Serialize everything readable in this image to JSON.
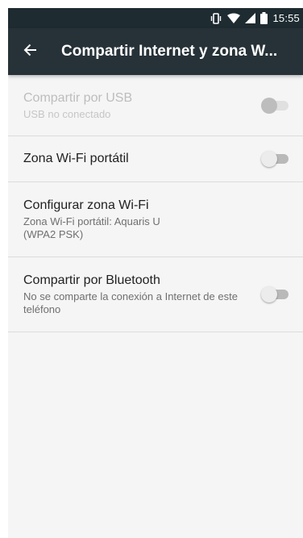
{
  "status_bar": {
    "time": "15:55",
    "icons": [
      "vibrate-icon",
      "wifi-icon",
      "cell-signal-icon",
      "battery-icon"
    ]
  },
  "app_bar": {
    "title": "Compartir Internet y zona W...",
    "back_icon": "arrow-back-icon"
  },
  "settings": {
    "usb": {
      "title": "Compartir por USB",
      "summary": "USB no conectado",
      "enabled": false,
      "checked": false
    },
    "hotspot": {
      "title": "Zona Wi-Fi portátil",
      "checked": false
    },
    "config": {
      "title": "Configurar zona Wi-Fi",
      "summary_line1": "Zona Wi-Fi portátil: Aquaris U",
      "summary_line2": "(WPA2 PSK)"
    },
    "bluetooth": {
      "title": "Compartir por Bluetooth",
      "summary": "No se comparte la conexión a Internet de este teléfono",
      "checked": false
    }
  },
  "colors": {
    "app_bar": "#263238",
    "status_bar": "#1e2b31",
    "background": "#f5f5f5",
    "divider": "#dcdcdc"
  }
}
